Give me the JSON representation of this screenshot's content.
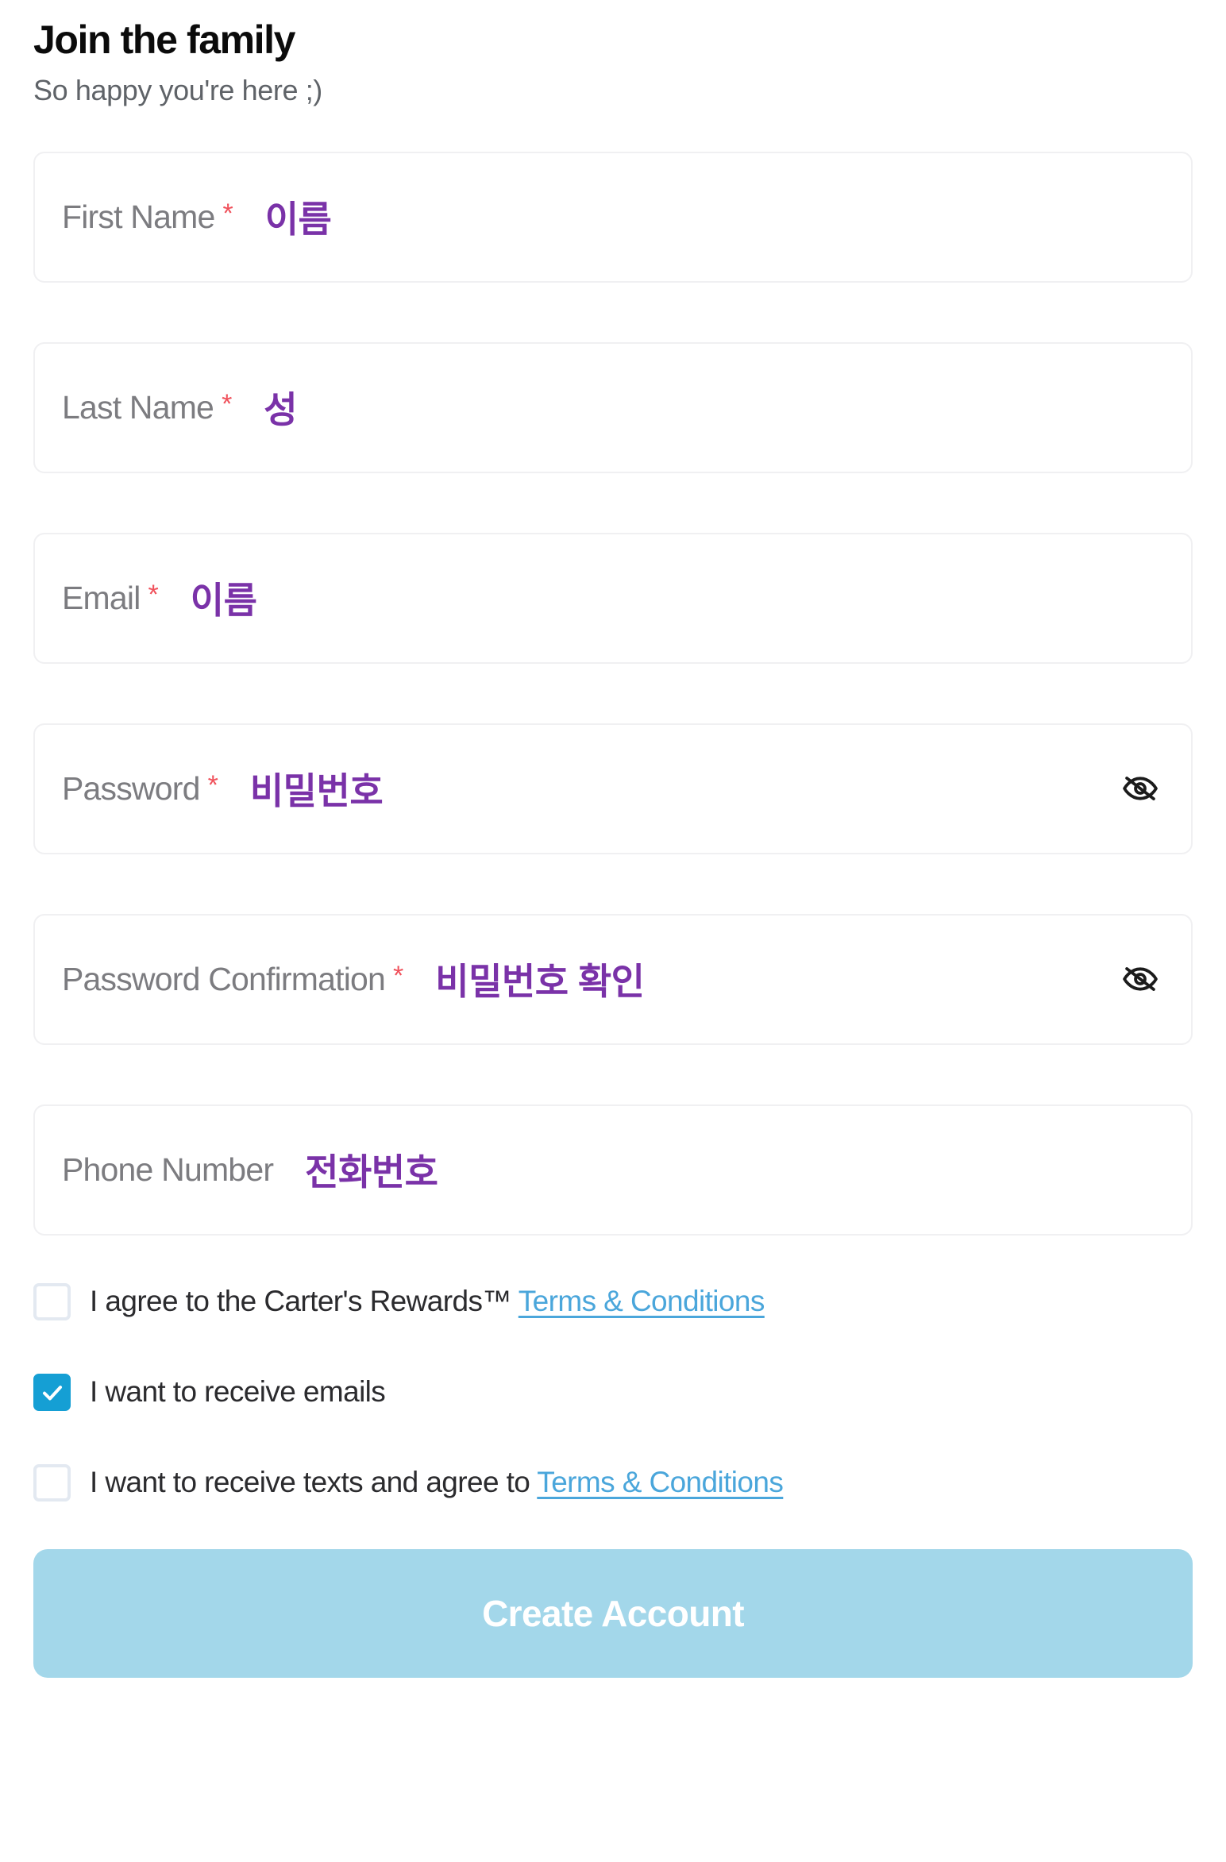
{
  "header": {
    "title": "Join the family",
    "subtitle": "So happy you're here ;)"
  },
  "form": {
    "fields": [
      {
        "name": "first-name",
        "label": "First Name",
        "required": true,
        "required_mark": "*",
        "annotation": "이름",
        "has_eye_toggle": false
      },
      {
        "name": "last-name",
        "label": "Last Name",
        "required": true,
        "required_mark": "*",
        "annotation": "성",
        "has_eye_toggle": false
      },
      {
        "name": "email",
        "label": "Email",
        "required": true,
        "required_mark": "*",
        "annotation": "이름",
        "has_eye_toggle": false
      },
      {
        "name": "password",
        "label": "Password",
        "required": true,
        "required_mark": "*",
        "annotation": "비밀번호",
        "has_eye_toggle": true
      },
      {
        "name": "password-confirmation",
        "label": "Password Confirmation",
        "required": true,
        "required_mark": "*",
        "annotation": "비밀번호 확인",
        "has_eye_toggle": true
      },
      {
        "name": "phone-number",
        "label": "Phone Number",
        "required": false,
        "required_mark": "",
        "annotation": "전화번호",
        "has_eye_toggle": false
      }
    ],
    "checkboxes": [
      {
        "name": "rewards-terms",
        "checked": false,
        "text": "I agree to the Carter's Rewards™ ",
        "link_text": "Terms & Conditions"
      },
      {
        "name": "receive-emails",
        "checked": true,
        "text": "I want to receive emails",
        "link_text": ""
      },
      {
        "name": "receive-texts",
        "checked": false,
        "text": "I want to receive texts and agree to ",
        "link_text": "Terms & Conditions"
      }
    ],
    "submit_label": "Create Account"
  },
  "icons": {
    "eye_toggle": "eye-off-icon",
    "checkmark": "check-icon"
  },
  "colors": {
    "annotation_purple": "#7a32a8",
    "required_red": "#f0515b",
    "link_blue": "#4aa6db",
    "checkbox_checked_blue": "#159fd4",
    "submit_button": "#a3d7ea",
    "label_gray": "#7c7c80",
    "title_black": "#0b0b0b"
  }
}
